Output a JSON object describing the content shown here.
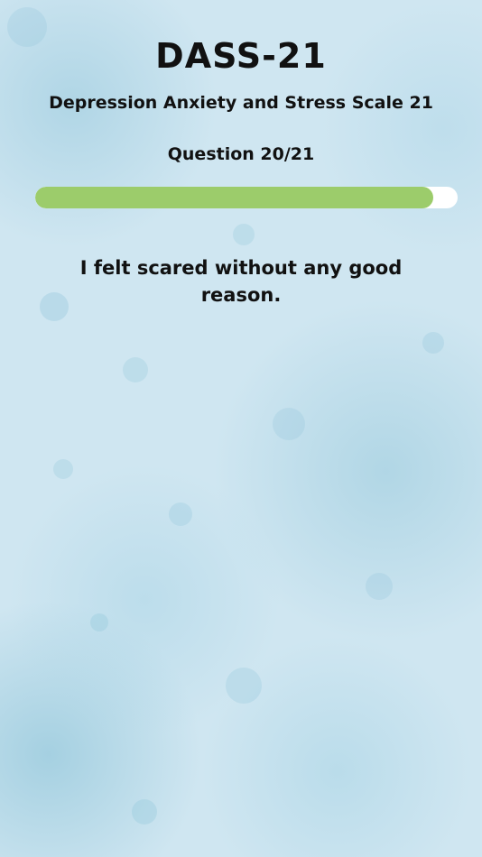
{
  "header": {
    "title": "DASS-21",
    "subtitle": "Depression Anxiety and Stress Scale 21",
    "question_counter": "Question 20/21"
  },
  "progress": {
    "value": 0.943,
    "fill_color": "#9ccc6b",
    "track_color": "#ffffff"
  },
  "question": {
    "text": "I felt scared without any good reason."
  },
  "colors": {
    "background": "#cfe6f1"
  }
}
